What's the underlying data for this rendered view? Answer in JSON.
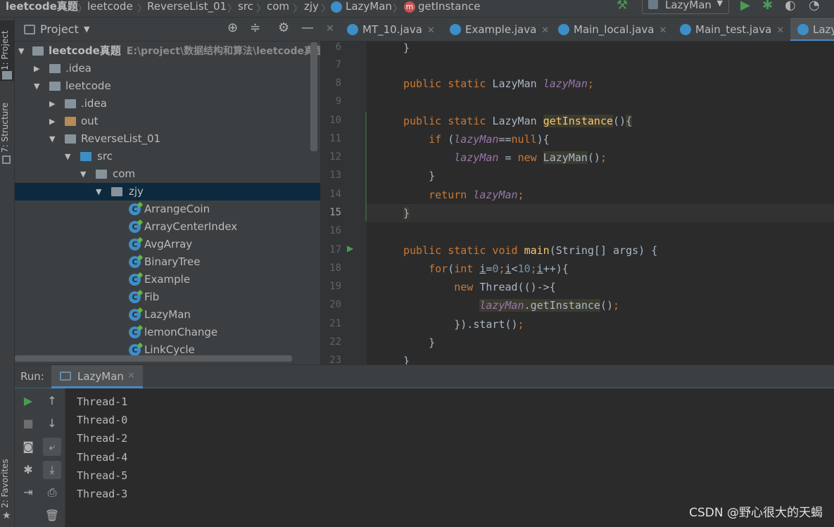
{
  "breadcrumb": {
    "items": [
      "leetcode真题",
      "leetcode",
      "ReverseList_01",
      "src",
      "com",
      "zjy",
      "LazyMan",
      "getInstance"
    ]
  },
  "toolbar": {
    "run_config": "LazyMan"
  },
  "sidebar_tabs": {
    "project": "1: Project",
    "structure": "7: Structure",
    "favorites": "2: Favorites"
  },
  "project_panel": {
    "title": "Project",
    "tree": [
      {
        "label": "leetcode真题",
        "path": "E:\\project\\数据结构和算法\\leetcode真题",
        "type": "module"
      },
      {
        "label": ".idea",
        "type": "folder"
      },
      {
        "label": "leetcode",
        "type": "folder"
      },
      {
        "label": ".idea",
        "type": "folder"
      },
      {
        "label": "out",
        "type": "folder"
      },
      {
        "label": "ReverseList_01",
        "type": "folder"
      },
      {
        "label": "src",
        "type": "source"
      },
      {
        "label": "com",
        "type": "package"
      },
      {
        "label": "zjy",
        "type": "package"
      },
      {
        "label": "ArrangeCoin",
        "type": "class"
      },
      {
        "label": "ArrayCenterIndex",
        "type": "class"
      },
      {
        "label": "AvgArray",
        "type": "class"
      },
      {
        "label": "BinaryTree",
        "type": "class"
      },
      {
        "label": "Example",
        "type": "class"
      },
      {
        "label": "Fib",
        "type": "class"
      },
      {
        "label": "LazyMan",
        "type": "class"
      },
      {
        "label": "lemonChange",
        "type": "class"
      },
      {
        "label": "LinkCycle",
        "type": "class"
      }
    ]
  },
  "editor": {
    "tabs": [
      "MT_10.java",
      "Example.java",
      "Main_local.java",
      "Main_test.java",
      "Lazy"
    ],
    "line_numbers": [
      "6",
      "7",
      "8",
      "9",
      "10",
      "11",
      "12",
      "13",
      "14",
      "15",
      "16",
      "17",
      "18",
      "19",
      "20",
      "21",
      "22",
      "23"
    ],
    "current_line": "15"
  },
  "run_panel": {
    "label": "Run:",
    "tab": "LazyMan",
    "output": [
      "Thread-1",
      "Thread-0",
      "Thread-2",
      "Thread-4",
      "Thread-5",
      "Thread-3"
    ]
  },
  "watermark": "CSDN @野心很大的天蝎",
  "colors": {
    "background": "#2b2b2b",
    "panel": "#3c3f41",
    "selection": "#0d293e",
    "keyword": "#cc7832",
    "field": "#9876aa",
    "method": "#ffc66d",
    "number": "#6897bb"
  }
}
